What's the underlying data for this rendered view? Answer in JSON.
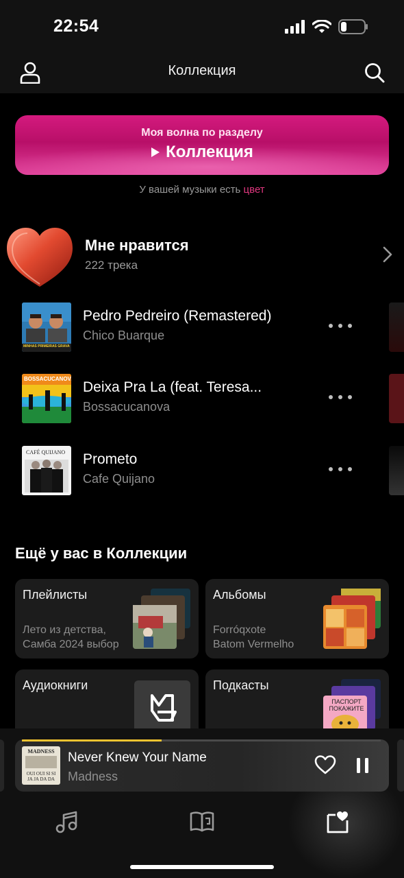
{
  "status": {
    "time": "22:54"
  },
  "header": {
    "title": "Коллекция"
  },
  "wave": {
    "subtitle": "Моя волна по разделу",
    "title": "Коллекция"
  },
  "hint": {
    "text": "У вашей музыки есть",
    "accent": "цвет"
  },
  "liked": {
    "title": "Мне нравится",
    "count": "222 трека"
  },
  "tracks": [
    {
      "title": "Pedro Pedreiro (Remastered)",
      "artist": "Chico Buarque",
      "cover_text": "MINHAS PRIMEIRAS GRAVAÇÕES"
    },
    {
      "title": "Deixa Pra La (feat. Teresa...",
      "artist": "Bossacucanova",
      "cover_text": "BOSSACUCANOVA"
    },
    {
      "title": "Prometo",
      "artist": "Cafe Quijano",
      "cover_text": "CAFÉ QUIJANO"
    }
  ],
  "more_section": {
    "title": "Ещё у вас в Коллекции",
    "cards": [
      {
        "title": "Плейлисты",
        "sub1": "Лето из детства,",
        "sub2": "Самба 2024 выбор"
      },
      {
        "title": "Альбомы",
        "sub1": "Forróqxote",
        "sub2": "Batom Vermelho"
      },
      {
        "title": "Аудиокниги",
        "sub1": "",
        "sub2": ""
      },
      {
        "title": "Подкасты",
        "sub1": "",
        "sub2": "",
        "cover_text": "ПАСПОРТ ПОКАЖИТЕ"
      }
    ]
  },
  "player": {
    "title": "Never Knew Your Name",
    "artist": "Madness",
    "progress": 0.39,
    "cover_text": "MADNESS",
    "cover_text2": "OUI OUI SI SI JA JA DA DA"
  },
  "colors": {
    "accent": "#e0377f",
    "wave_banner": "#c8147a",
    "progress": "#f4c430",
    "background": "#000000",
    "bar": "#121212",
    "card": "#1c1c1c"
  },
  "icons": {
    "profile": "user-icon",
    "search": "search-icon",
    "play": "play-icon",
    "chevron": "chevron-right-icon",
    "more": "more-horizontal-icon",
    "like": "heart-icon",
    "pause": "pause-icon",
    "music_tab": "music-note-icon",
    "books_tab": "book-icon",
    "collection_tab": "collection-heart-icon"
  }
}
